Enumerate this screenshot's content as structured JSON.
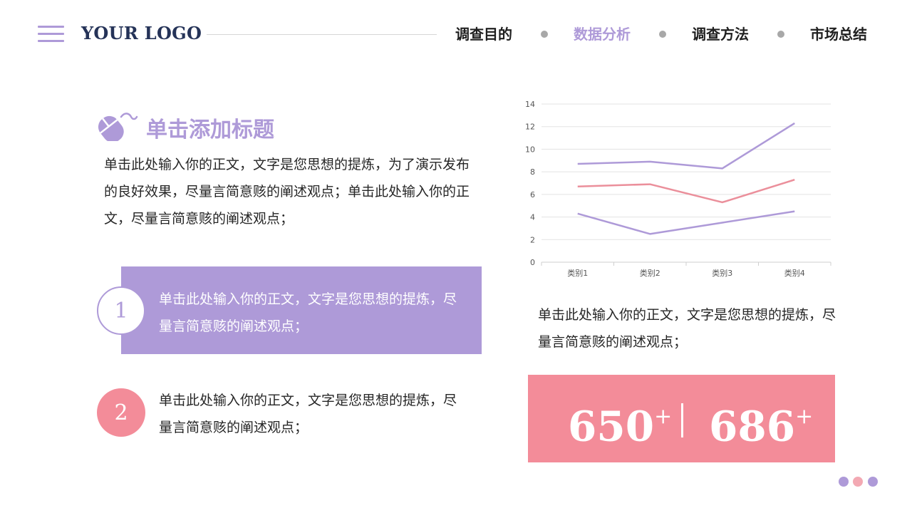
{
  "header": {
    "logo": "YOUR LOGO",
    "nav": [
      {
        "label": "调查目的",
        "active": false
      },
      {
        "label": "数据分析",
        "active": true
      },
      {
        "label": "调查方法",
        "active": false
      },
      {
        "label": "市场总结",
        "active": false
      }
    ],
    "menu_icon": "hamburger-icon"
  },
  "section": {
    "icon": "mouse-icon",
    "title": "单击添加标题",
    "intro": "单击此处输入你的正文，文字是您思想的提炼，为了演示发布的良好效果，尽量言简意赅的阐述观点；单击此处输入你的正文，尽量言简意赅的阐述观点；"
  },
  "items": [
    {
      "number": "1",
      "text": "单击此处输入你的正文，文字是您思想的提炼，尽量言简意赅的阐述观点；"
    },
    {
      "number": "2",
      "text": "单击此处输入你的正文，文字是您思想的提炼，尽量言简意赅的阐述观点；"
    }
  ],
  "chart_caption": "单击此处输入你的正文，文字是您思想的提炼，尽量言简意赅的阐述观点；",
  "stats": {
    "a": {
      "value": "650",
      "suffix": "+"
    },
    "b": {
      "value": "686",
      "suffix": "+"
    },
    "separator": "|"
  },
  "colors": {
    "accent_purple": "#ae9ad8",
    "accent_pink": "#f38c99",
    "logo_navy": "#253358"
  },
  "chart_data": {
    "type": "line",
    "title": "",
    "xlabel": "",
    "ylabel": "",
    "categories": [
      "类别1",
      "类别2",
      "类别3",
      "类别4"
    ],
    "ylim": [
      0,
      14
    ],
    "yticks": [
      0,
      2,
      4,
      6,
      8,
      10,
      12,
      14
    ],
    "grid": true,
    "legend": "none",
    "series": [
      {
        "values": [
          8.7,
          8.9,
          8.3,
          12.3
        ],
        "color": "#ae9ad8"
      },
      {
        "values": [
          6.7,
          6.9,
          5.3,
          7.3
        ],
        "color": "#eb8f9b"
      },
      {
        "values": [
          4.3,
          2.5,
          3.5,
          4.5
        ],
        "color": "#ae9ad8"
      }
    ]
  }
}
